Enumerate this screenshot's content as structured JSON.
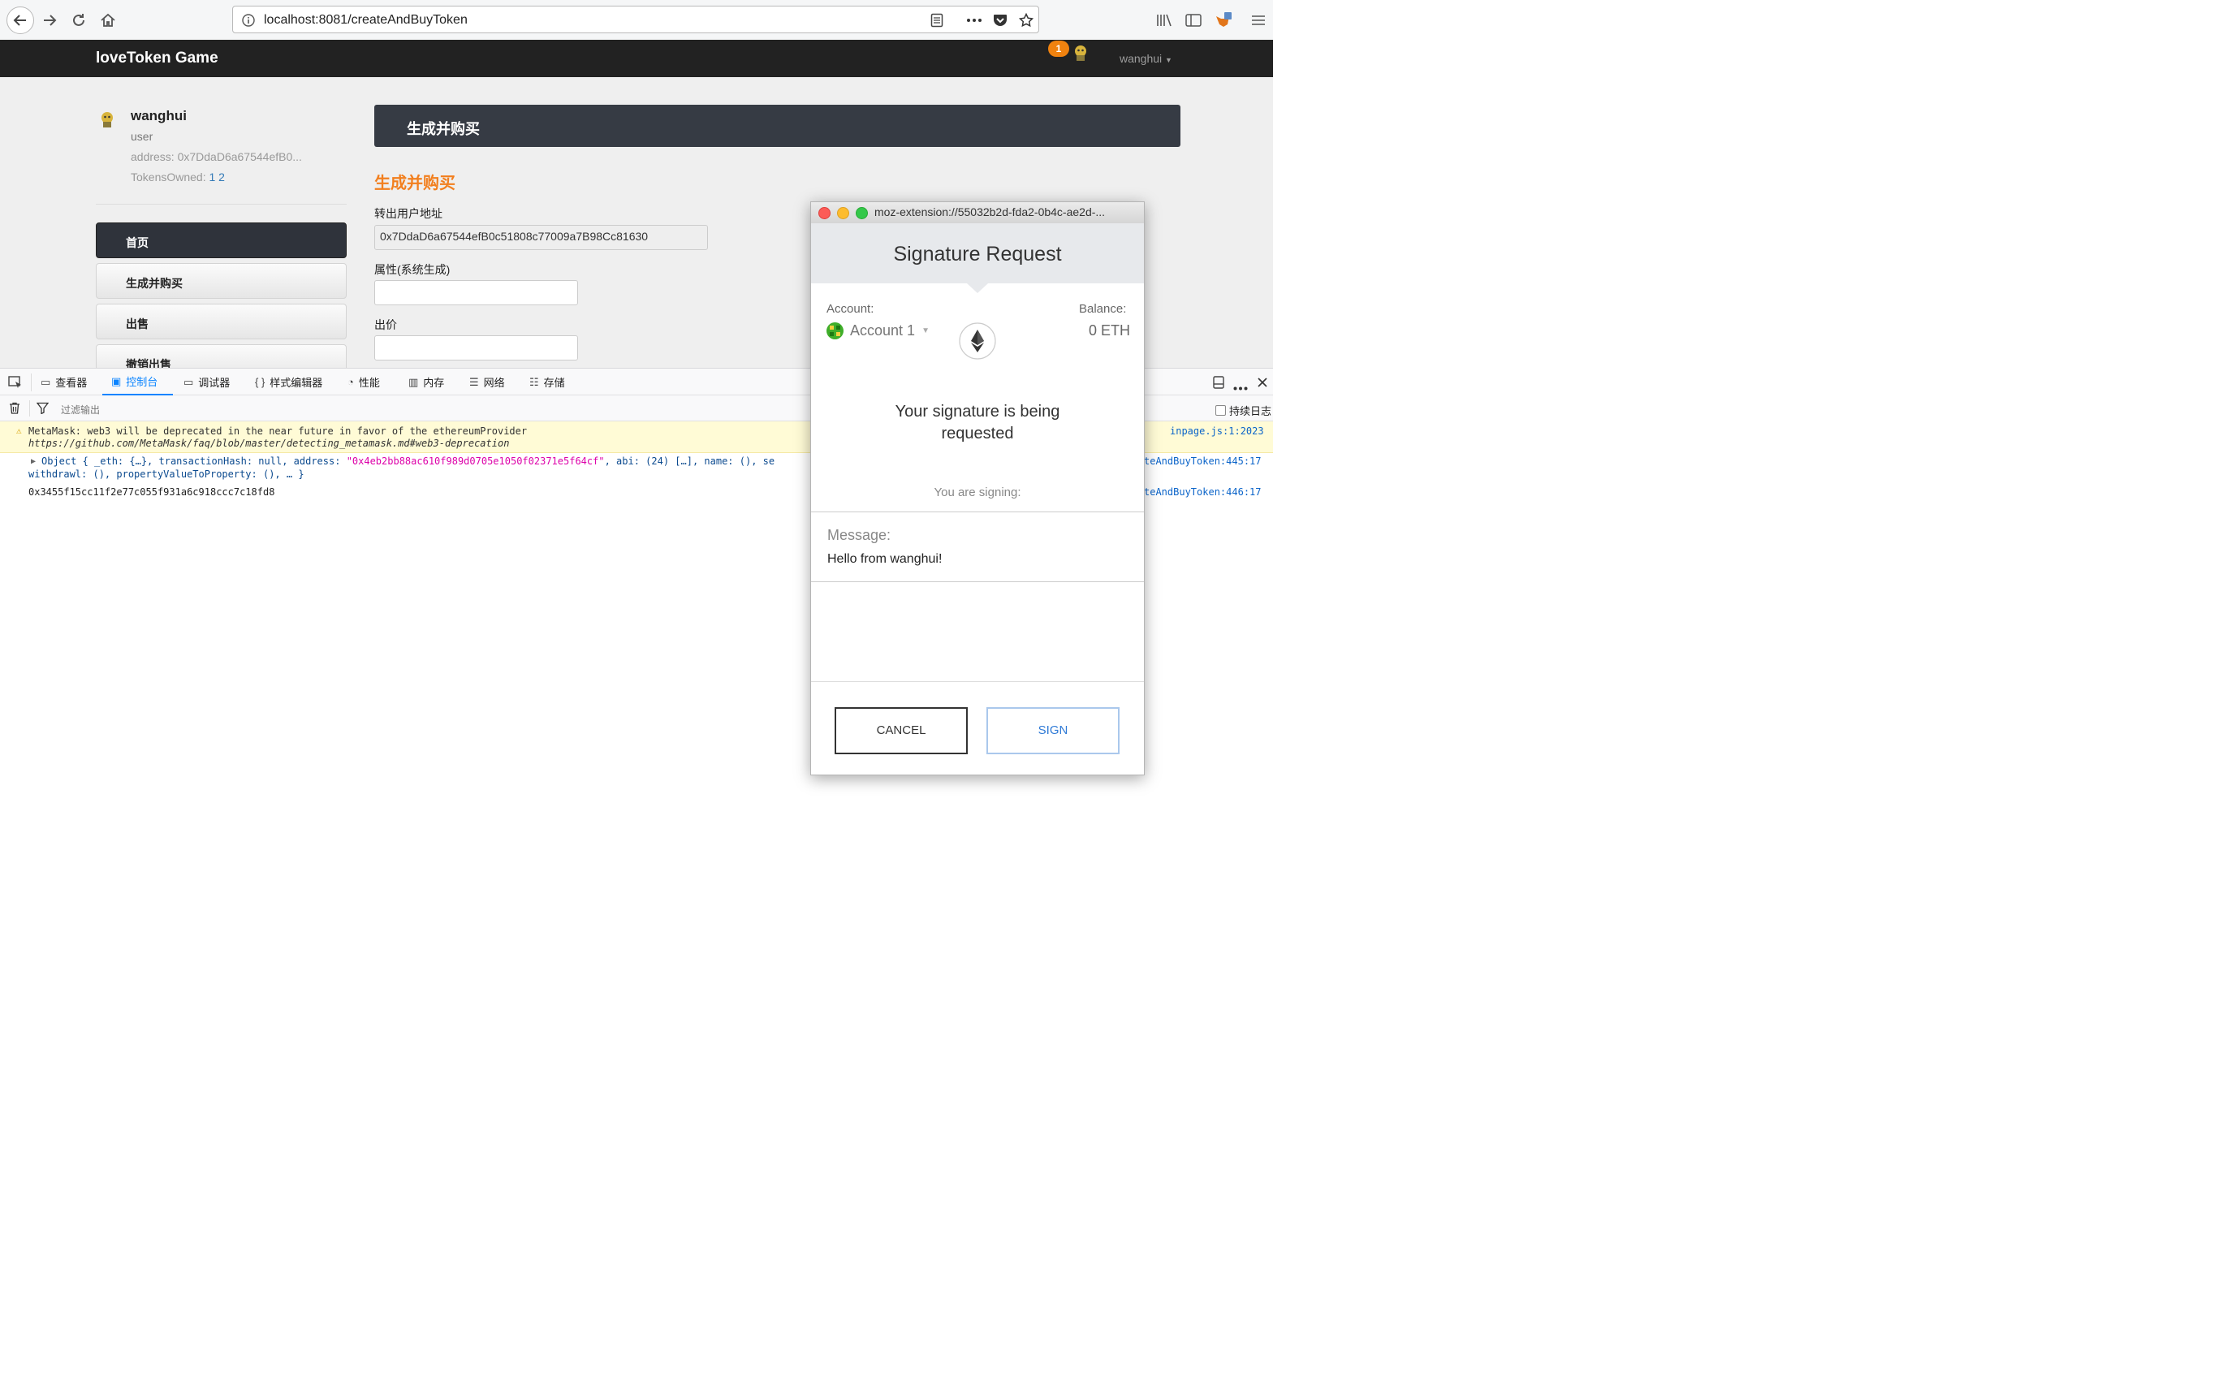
{
  "browser": {
    "url": "localhost:8081/createAndBuyToken"
  },
  "app": {
    "brand": "loveToken Game",
    "notification_count": "1",
    "nav_user": "wanghui"
  },
  "profile": {
    "name": "wanghui",
    "role": "user",
    "address": "address: 0x7DdaD6a67544efB0...",
    "tokens_label": "TokensOwned:",
    "tokens_value": "1 2"
  },
  "sidebar": {
    "items": [
      {
        "label": "首页"
      },
      {
        "label": "生成并购买"
      },
      {
        "label": "出售"
      },
      {
        "label": "撤销出售"
      }
    ]
  },
  "main": {
    "panel_title": "生成并购买",
    "section_title": "生成并购买",
    "fields": [
      {
        "label": "转出用户地址",
        "value": "0x7DdaD6a67544efB0c51808c77009a7B98Cc81630"
      },
      {
        "label": "属性(系统生成)",
        "value": ""
      },
      {
        "label": "出价",
        "value": ""
      }
    ]
  },
  "devtools": {
    "tabs": [
      {
        "label": "查看器",
        "icon": "inspector-icon"
      },
      {
        "label": "控制台",
        "icon": "console-icon"
      },
      {
        "label": "调试器",
        "icon": "debugger-icon"
      },
      {
        "label": "样式编辑器",
        "icon": "style-editor-icon"
      },
      {
        "label": "性能",
        "icon": "performance-icon"
      },
      {
        "label": "内存",
        "icon": "memory-icon"
      },
      {
        "label": "网络",
        "icon": "network-icon"
      },
      {
        "label": "存储",
        "icon": "storage-icon"
      }
    ],
    "filter_placeholder": "过滤输出",
    "persist_logs": "持续日志",
    "console": {
      "warning_line1": "MetaMask: web3 will be deprecated in the near future in favor of the ethereumProvider",
      "warning_line2": "https://github.com/MetaMask/faq/blob/master/detecting_metamask.md#web3-deprecation",
      "warning_source": "inpage.js:1:2023",
      "object_prefix": "Object { _eth: {…}, transactionHash: null, address: ",
      "object_address": "\"0x4eb2bb88ac610f989d0705e1050f02371e5f64cf\"",
      "object_suffix": ", abi: (24) […], name: (), se",
      "object_line2": "withdrawl: (), propertyValueToProperty: (), … }",
      "object_source": "teAndBuyToken:445:17",
      "hash_line": "0x3455f15cc11f2e77c055f931a6c918ccc7c18fd8",
      "hash_source": "teAndBuyToken:446:17"
    }
  },
  "metamask": {
    "window_title": "moz-extension://55032b2d-fda2-0b4c-ae2d-...",
    "heading": "Signature Request",
    "account_label": "Account:",
    "account_name": "Account 1",
    "balance_label": "Balance:",
    "balance_value": "0 ETH",
    "signature_line1": "Your signature is being",
    "signature_line2": "requested",
    "signing_label": "You are signing:",
    "message_label": "Message:",
    "message_value": "Hello from wanghui!",
    "cancel_label": "CANCEL",
    "sign_label": "SIGN"
  }
}
